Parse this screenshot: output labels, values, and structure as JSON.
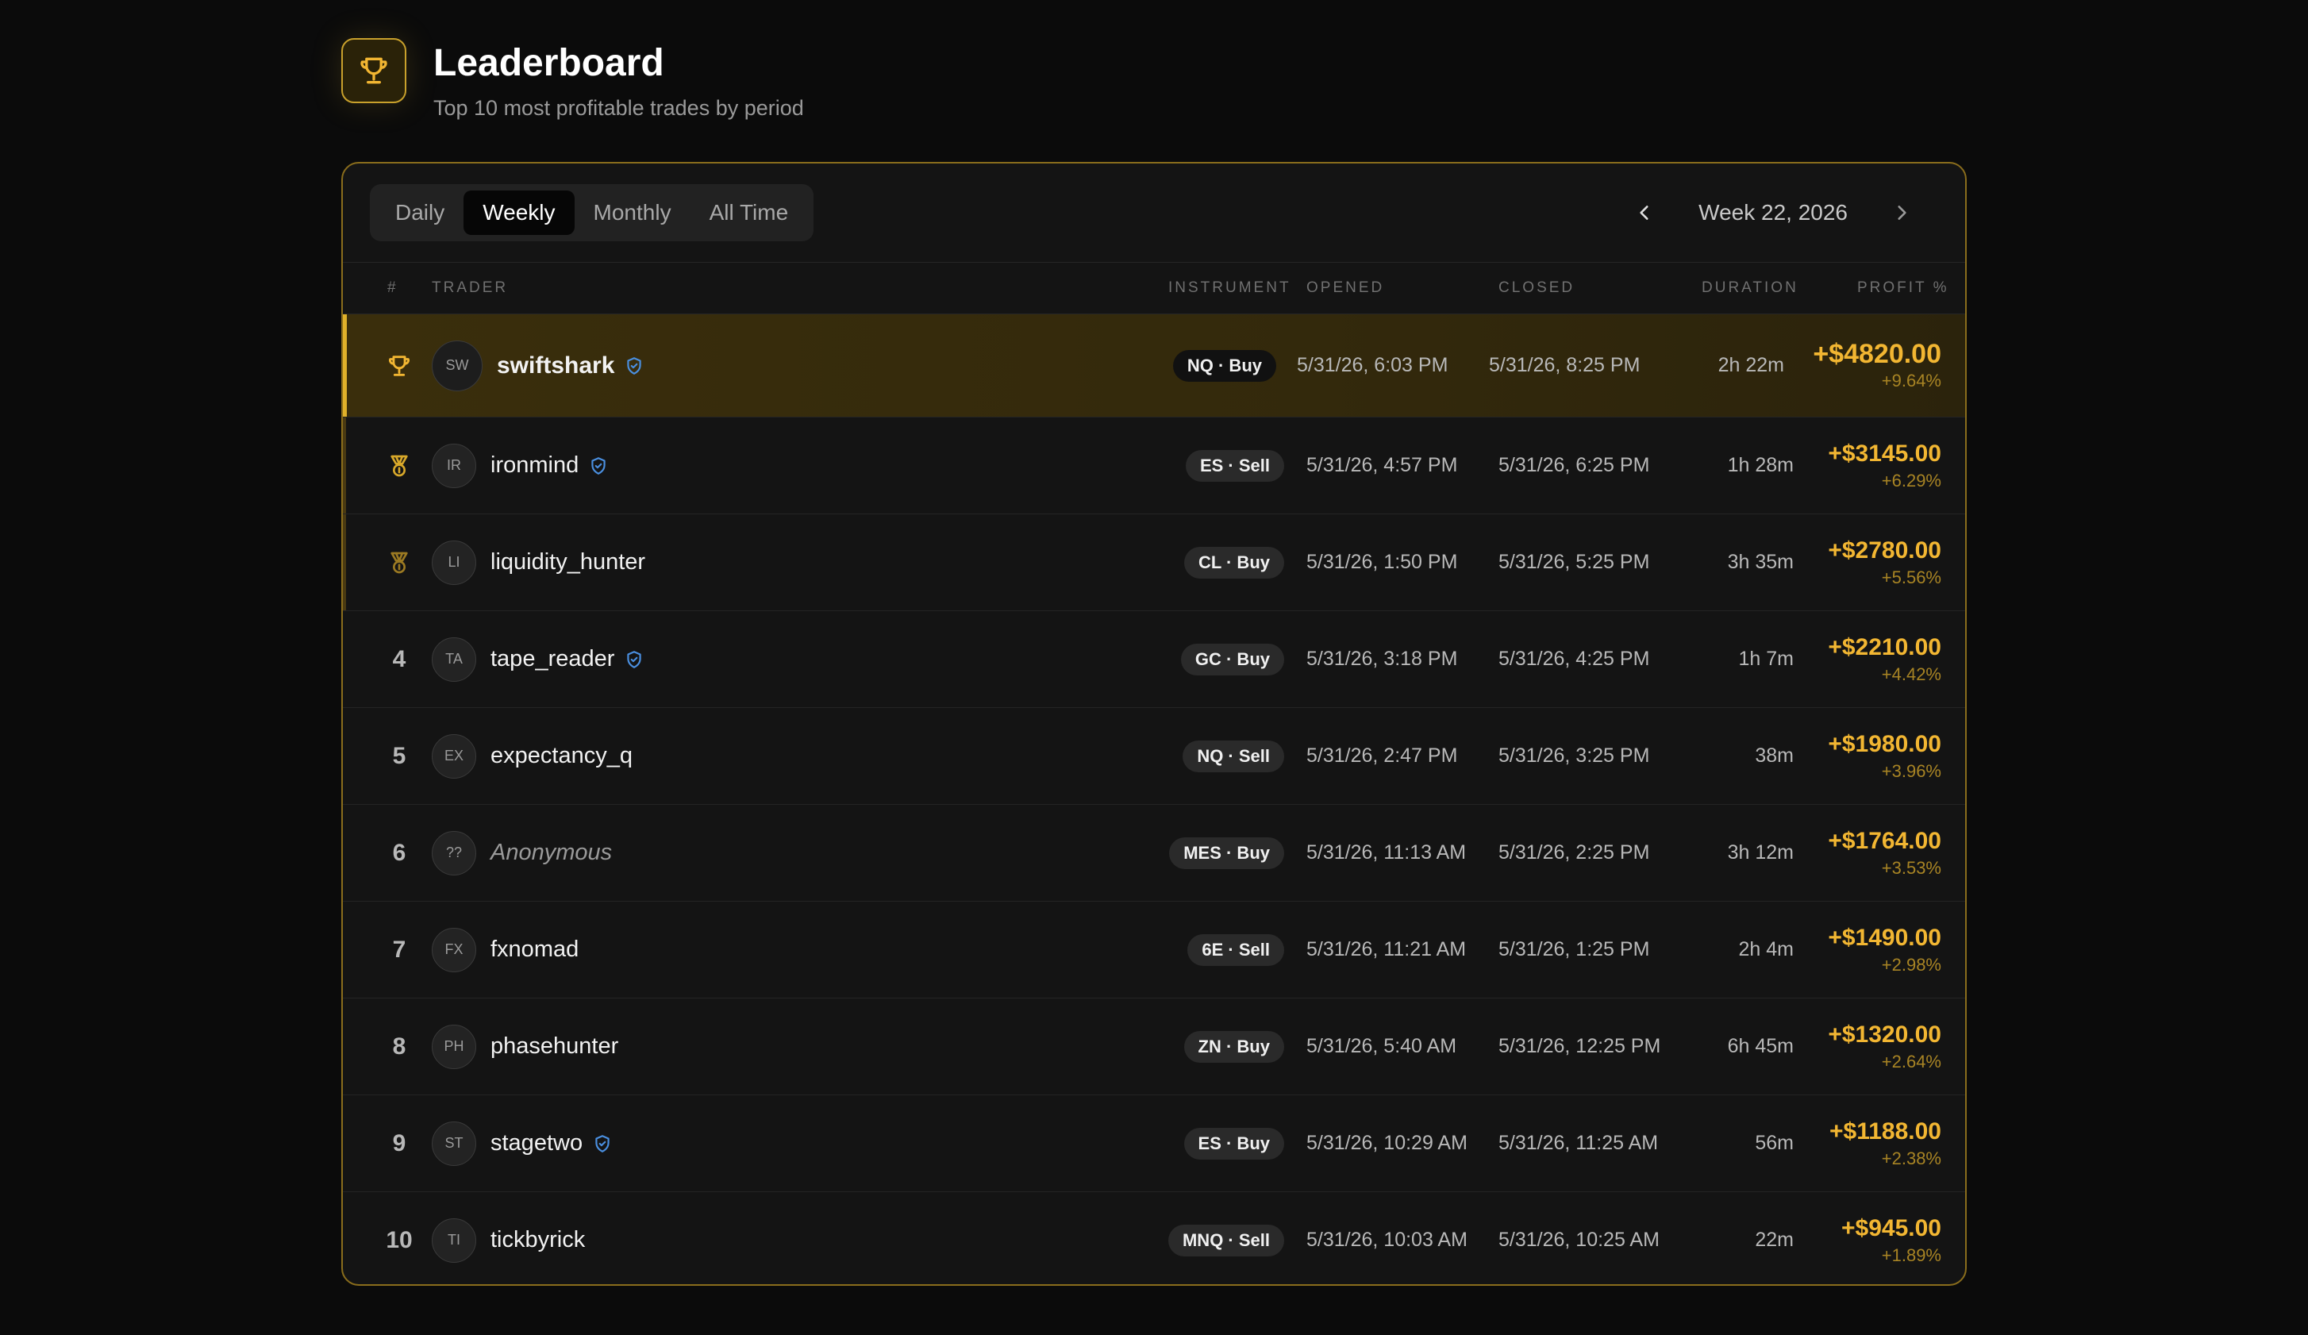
{
  "header": {
    "title": "Leaderboard",
    "subtitle": "Top 10 most profitable trades by period"
  },
  "tabs": [
    {
      "label": "Daily",
      "active": false
    },
    {
      "label": "Weekly",
      "active": true
    },
    {
      "label": "Monthly",
      "active": false
    },
    {
      "label": "All Time",
      "active": false
    }
  ],
  "period": {
    "label": "Week 22, 2026"
  },
  "columns": {
    "rank": "#",
    "trader": "TRADER",
    "instrument": "INSTRUMENT",
    "opened": "OPENED",
    "closed": "CLOSED",
    "duration": "DURATION",
    "profit": "PROFIT %"
  },
  "colors": {
    "accent": "#f2b632",
    "verified": "#4a8fe0",
    "gold_row": "#3a2e0c"
  },
  "rows": [
    {
      "rank": "1",
      "icon": "trophy-icon",
      "initials": "SW",
      "name": "swiftshark",
      "verified": true,
      "anonymous": false,
      "instrument": "NQ · Buy",
      "opened": "5/31/26, 6:03 PM",
      "closed": "5/31/26, 8:25 PM",
      "duration": "2h 22m",
      "profit": "+$4820.00",
      "pct": "+9.64%"
    },
    {
      "rank": "2",
      "icon": "medal-icon",
      "initials": "IR",
      "name": "ironmind",
      "verified": true,
      "anonymous": false,
      "instrument": "ES · Sell",
      "opened": "5/31/26, 4:57 PM",
      "closed": "5/31/26, 6:25 PM",
      "duration": "1h 28m",
      "profit": "+$3145.00",
      "pct": "+6.29%"
    },
    {
      "rank": "3",
      "icon": "medal-icon",
      "initials": "LI",
      "name": "liquidity_hunter",
      "verified": false,
      "anonymous": false,
      "instrument": "CL · Buy",
      "opened": "5/31/26, 1:50 PM",
      "closed": "5/31/26, 5:25 PM",
      "duration": "3h 35m",
      "profit": "+$2780.00",
      "pct": "+5.56%"
    },
    {
      "rank": "4",
      "icon": "",
      "initials": "TA",
      "name": "tape_reader",
      "verified": true,
      "anonymous": false,
      "instrument": "GC · Buy",
      "opened": "5/31/26, 3:18 PM",
      "closed": "5/31/26, 4:25 PM",
      "duration": "1h 7m",
      "profit": "+$2210.00",
      "pct": "+4.42%"
    },
    {
      "rank": "5",
      "icon": "",
      "initials": "EX",
      "name": "expectancy_q",
      "verified": false,
      "anonymous": false,
      "instrument": "NQ · Sell",
      "opened": "5/31/26, 2:47 PM",
      "closed": "5/31/26, 3:25 PM",
      "duration": "38m",
      "profit": "+$1980.00",
      "pct": "+3.96%"
    },
    {
      "rank": "6",
      "icon": "",
      "initials": "??",
      "name": "Anonymous",
      "verified": false,
      "anonymous": true,
      "instrument": "MES · Buy",
      "opened": "5/31/26, 11:13 AM",
      "closed": "5/31/26, 2:25 PM",
      "duration": "3h 12m",
      "profit": "+$1764.00",
      "pct": "+3.53%"
    },
    {
      "rank": "7",
      "icon": "",
      "initials": "FX",
      "name": "fxnomad",
      "verified": false,
      "anonymous": false,
      "instrument": "6E · Sell",
      "opened": "5/31/26, 11:21 AM",
      "closed": "5/31/26, 1:25 PM",
      "duration": "2h 4m",
      "profit": "+$1490.00",
      "pct": "+2.98%"
    },
    {
      "rank": "8",
      "icon": "",
      "initials": "PH",
      "name": "phasehunter",
      "verified": false,
      "anonymous": false,
      "instrument": "ZN · Buy",
      "opened": "5/31/26, 5:40 AM",
      "closed": "5/31/26, 12:25 PM",
      "duration": "6h 45m",
      "profit": "+$1320.00",
      "pct": "+2.64%"
    },
    {
      "rank": "9",
      "icon": "",
      "initials": "ST",
      "name": "stagetwo",
      "verified": true,
      "anonymous": false,
      "instrument": "ES · Buy",
      "opened": "5/31/26, 10:29 AM",
      "closed": "5/31/26, 11:25 AM",
      "duration": "56m",
      "profit": "+$1188.00",
      "pct": "+2.38%"
    },
    {
      "rank": "10",
      "icon": "",
      "initials": "TI",
      "name": "tickbyrick",
      "verified": false,
      "anonymous": false,
      "instrument": "MNQ · Sell",
      "opened": "5/31/26, 10:03 AM",
      "closed": "5/31/26, 10:25 AM",
      "duration": "22m",
      "profit": "+$945.00",
      "pct": "+1.89%"
    }
  ]
}
